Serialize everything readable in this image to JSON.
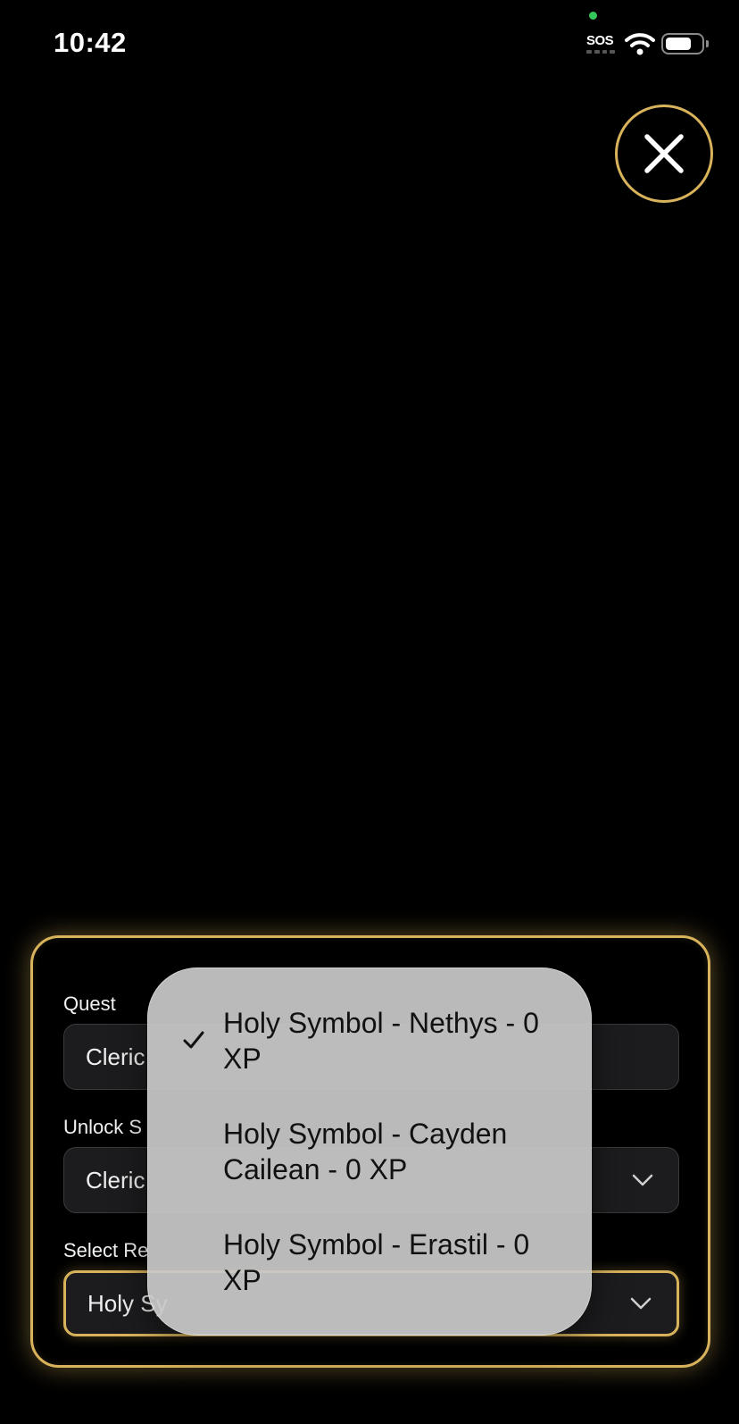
{
  "status_bar": {
    "time": "10:42",
    "sos": "SOS",
    "icons": [
      "wifi-icon",
      "battery-icon"
    ]
  },
  "close_button": {
    "icon": "close-icon"
  },
  "form": {
    "quest": {
      "label": "Quest",
      "value": "Cleric"
    },
    "unlock": {
      "label": "Unlock S",
      "value": "Cleric"
    },
    "reward": {
      "label": "Select Re",
      "value": "Holy Sy"
    }
  },
  "menu": {
    "items": [
      {
        "label": "Holy Symbol - Nethys - 0 XP",
        "selected": true
      },
      {
        "label": "Holy Symbol - Cayden Cailean - 0 XP",
        "selected": false
      },
      {
        "label": "Holy Symbol - Erastil - 0 XP",
        "selected": false
      }
    ]
  },
  "colors": {
    "accent": "#d9b35c",
    "background": "#000000",
    "field_bg": "#1c1c1e",
    "menu_bg": "#c8c8c8"
  }
}
